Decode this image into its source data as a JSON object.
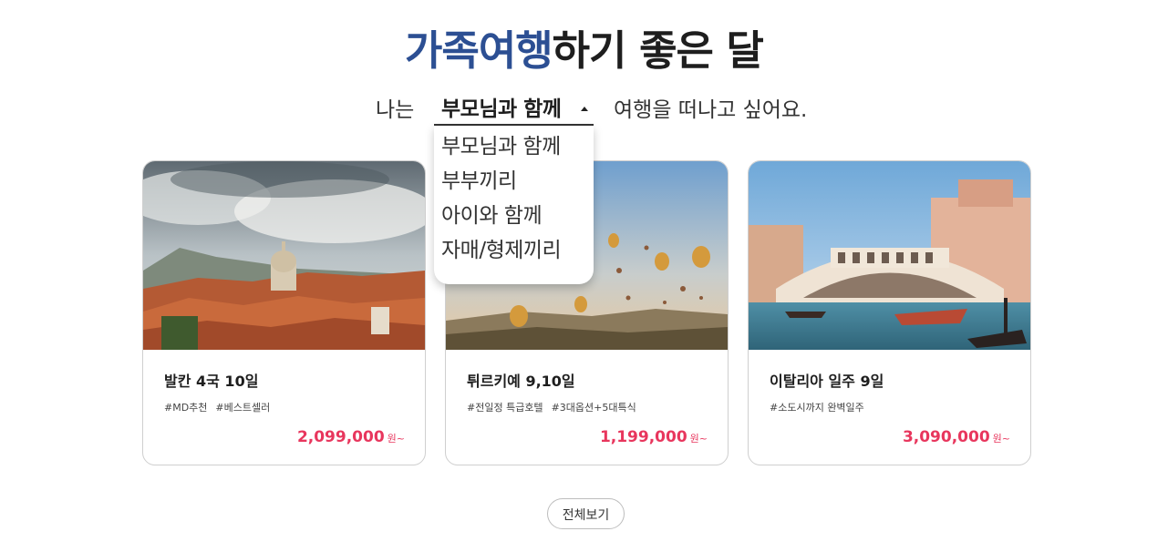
{
  "heading": {
    "accent": "가족여행",
    "rest": "하기 좋은 달"
  },
  "sentence": {
    "pre": "나는",
    "post": "여행을 떠나고 싶어요."
  },
  "companion_select": {
    "selected": "부모님과 함께",
    "options": [
      "부모님과 함께",
      "부부끼리",
      "아이와 함께",
      "자매/형제끼리"
    ]
  },
  "cards": [
    {
      "title": "발칸 4국 10일",
      "tags": [
        "#MD추천",
        "#베스트셀러"
      ],
      "price": "2,099,000",
      "unit": "원~"
    },
    {
      "title": "튀르키예 9,10일",
      "tags": [
        "#전일정 특급호텔",
        "#3대옵션+5대특식"
      ],
      "price": "1,199,000",
      "unit": "원~"
    },
    {
      "title": "이탈리아 일주 9일",
      "tags": [
        "#소도시까지 완벽일주"
      ],
      "price": "3,090,000",
      "unit": "원~"
    }
  ],
  "view_all": "전체보기",
  "colors": {
    "accent_blue": "#2c4f93",
    "price_red": "#e8365d"
  }
}
